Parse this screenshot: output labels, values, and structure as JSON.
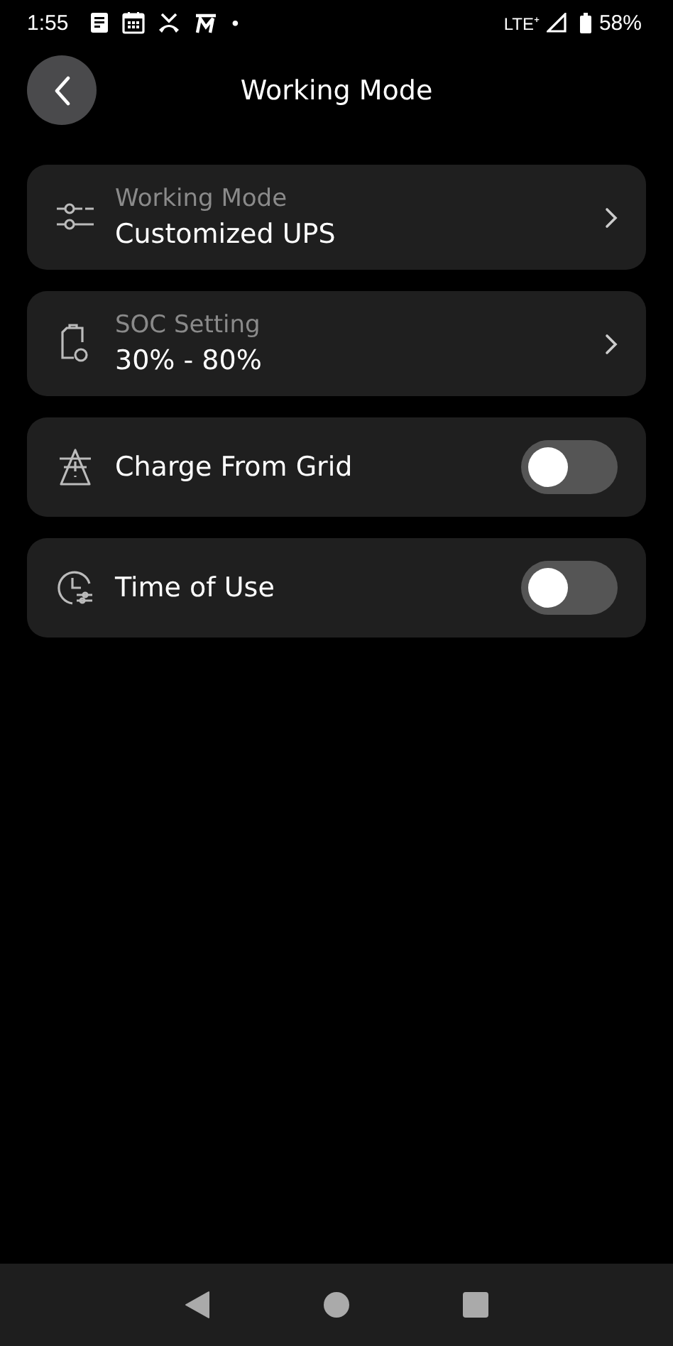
{
  "status_bar": {
    "time": "1:55",
    "dot": "•",
    "network": "LTE⁺",
    "battery": "58%"
  },
  "header": {
    "title": "Working Mode"
  },
  "settings": [
    {
      "kind": "nav",
      "label": "Working Mode",
      "value": "Customized UPS"
    },
    {
      "kind": "nav",
      "label": "SOC Setting",
      "value": "30% - 80%"
    },
    {
      "kind": "toggle",
      "label": "Charge From Grid",
      "on": false
    },
    {
      "kind": "toggle",
      "label": "Time of Use",
      "on": false
    }
  ]
}
